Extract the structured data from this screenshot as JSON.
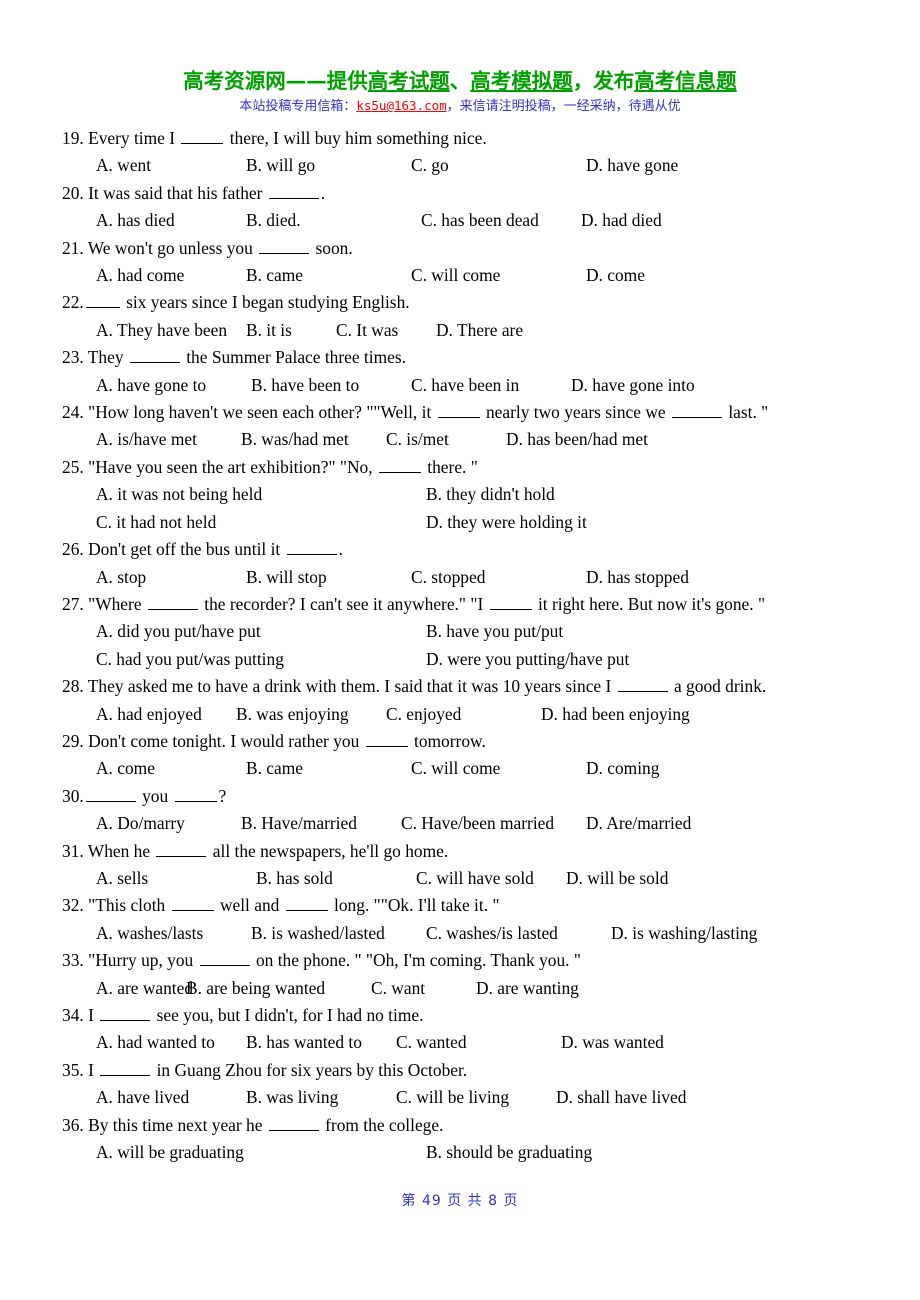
{
  "banner": {
    "title_parts": [
      {
        "text": "高考资源网——提供",
        "underline": false
      },
      {
        "text": "高考试题",
        "underline": true
      },
      {
        "text": "、",
        "underline": false
      },
      {
        "text": "高考模拟题",
        "underline": true
      },
      {
        "text": "，发布",
        "underline": false
      },
      {
        "text": "高考信息题",
        "underline": true
      }
    ],
    "title_full": "高考资源网——提供高考试题、高考模拟题，发布高考信息题",
    "sub_prefix": "本站投稿专用信箱：",
    "email": "ks5u@163.com",
    "sub_suffix": "，来信请注明投稿，一经采纳，待遇从优",
    "title_color": "#00a000",
    "sub_color": "#3333cc",
    "email_color": "#ff0000"
  },
  "footer": {
    "text": "第 49 页  共 8 页",
    "color": "#3333cc"
  },
  "questions": [
    {
      "number": "19.",
      "stem_before": "Every time I",
      "blank": "w4",
      "stem_after": "there, I will buy him something nice.",
      "option_layout": "cols4-a",
      "options": [
        "A. went",
        "B. will go",
        "C. go",
        "D. have gone"
      ]
    },
    {
      "number": "20.",
      "stem_before": "It was said that his father",
      "blank": "w5",
      "stem_after": ".",
      "option_layout": "cols4-b",
      "options": [
        "A. has died",
        "B. died.",
        "C. has been dead",
        "D. had died"
      ]
    },
    {
      "number": "21.",
      "stem_before": "We won't go unless you",
      "blank": "w5",
      "stem_after": "soon.",
      "option_layout": "cols4-a",
      "options": [
        "A. had come",
        "B. came",
        "C. will come",
        "D. come"
      ]
    },
    {
      "number": "22.",
      "stem_before": "",
      "blank": "w3",
      "stem_after": "six years since I began studying English.",
      "option_layout": "cols4-c",
      "options": [
        "A. They have been",
        "B. it is",
        "C. It was",
        "D. There are"
      ]
    },
    {
      "number": "23.",
      "stem_before": "They",
      "blank": "w5",
      "stem_after": "the Summer Palace three times.",
      "option_layout": "cols4-d",
      "options": [
        "A. have gone to",
        "B. have been to",
        "C. have been in",
        "D. have gone into"
      ]
    },
    {
      "number": "24.",
      "stem_before": "\"How long haven't we seen each other? \"\"Well, it",
      "blank": "w4",
      "stem_after": "nearly two years since we",
      "blank2": "w5",
      "stem_end": "last. \"",
      "option_layout": "cols4-e",
      "options": [
        "A. is/have met",
        "B. was/had met",
        "C. is/met",
        "D. has been/had met"
      ]
    },
    {
      "number": "25.",
      "stem_before": "\"Have you seen the art exhibition?\" \"No,",
      "blank": "w4",
      "stem_after": "there. \"",
      "option_layout": "two-by-two",
      "options": [
        "A. it was not being held",
        "B. they didn't hold",
        "C. it had not held",
        "D. they were holding it"
      ]
    },
    {
      "number": "26.",
      "stem_before": "Don't get off the bus until it",
      "blank": "w5",
      "stem_after": ".",
      "option_layout": "cols4-a",
      "options": [
        "A. stop",
        "B. will stop",
        "C. stopped",
        "D. has stopped"
      ]
    },
    {
      "number": "27.",
      "stem_before": "\"Where",
      "blank": "w5",
      "stem_after": "the recorder? I can't see it anywhere.\" \"I",
      "blank2": "w4",
      "stem_end": "it right here. But now it's gone. \"",
      "option_layout": "two-by-two-wide",
      "options": [
        "A. did you put/have put",
        "B. have you put/put",
        "C. had you put/was putting",
        "D. were you putting/have put"
      ]
    },
    {
      "number": "28.",
      "stem_before": "They asked me to have a drink with them. I said that it was 10 years since I",
      "blank": "w5",
      "stem_after": "a good drink.",
      "option_layout": "cols4-f",
      "options": [
        "A. had enjoyed",
        "B. was enjoying",
        "C. enjoyed",
        "D. had been enjoying"
      ]
    },
    {
      "number": "29.",
      "stem_before": "Don't come tonight. I would rather you",
      "blank": "w4",
      "stem_after": "tomorrow.",
      "option_layout": "cols4-a",
      "options": [
        "A. come",
        "B. came",
        "C. will come",
        "D. coming"
      ]
    },
    {
      "number": "30.",
      "stem_before": "",
      "blank": "w5",
      "stem_after": "you",
      "blank2": "w4",
      "stem_end": "?",
      "option_layout": "cols4-g",
      "options": [
        "A. Do/marry",
        "B. Have/married",
        "C. Have/been married",
        "D. Are/married"
      ]
    },
    {
      "number": "31.",
      "stem_before": "When he",
      "blank": "w5",
      "stem_after": "all the newspapers, he'll go home.",
      "option_layout": "cols4-h",
      "options": [
        "A. sells",
        "B. has sold",
        "C. will have sold",
        "D. will be sold"
      ]
    },
    {
      "number": "32.",
      "stem_before": "\"This cloth",
      "blank": "w4",
      "stem_after": "well and",
      "blank2": "w4",
      "stem_end": "long. \"\"Ok. I'll take it. \"",
      "option_layout": "cols4-i",
      "options": [
        "A. washes/lasts",
        "B. is washed/lasted",
        "C. washes/is lasted",
        "D. is washing/lasting"
      ]
    },
    {
      "number": "33.",
      "stem_before": "\"Hurry up, you",
      "blank": "w5",
      "stem_after": "on the phone. \" \"Oh, I'm coming. Thank you. \"",
      "option_layout": "cols4-j",
      "options": [
        "A. are wanted",
        "B. are being wanted",
        "C. want",
        "D. are wanting"
      ]
    },
    {
      "number": "34.",
      "stem_before": "I",
      "blank": "w5",
      "stem_after": "see you, but I didn't, for I had no time.",
      "option_layout": "cols4-k",
      "options": [
        "A. had wanted to",
        "B. has wanted to",
        "C. wanted",
        "D. was wanted"
      ]
    },
    {
      "number": "35.",
      "stem_before": "I",
      "blank": "w5",
      "stem_after": "in Guang Zhou for six years by this October.",
      "option_layout": "cols4-l",
      "options": [
        "A. have lived",
        "B. was living",
        "C. will be living",
        "D. shall have lived"
      ]
    },
    {
      "number": "36.",
      "stem_before": "By this time next year he",
      "blank": "w5",
      "stem_after": "from the college.",
      "option_layout": "two-only",
      "options": [
        "A. will be graduating",
        "B. should be graduating"
      ]
    }
  ]
}
